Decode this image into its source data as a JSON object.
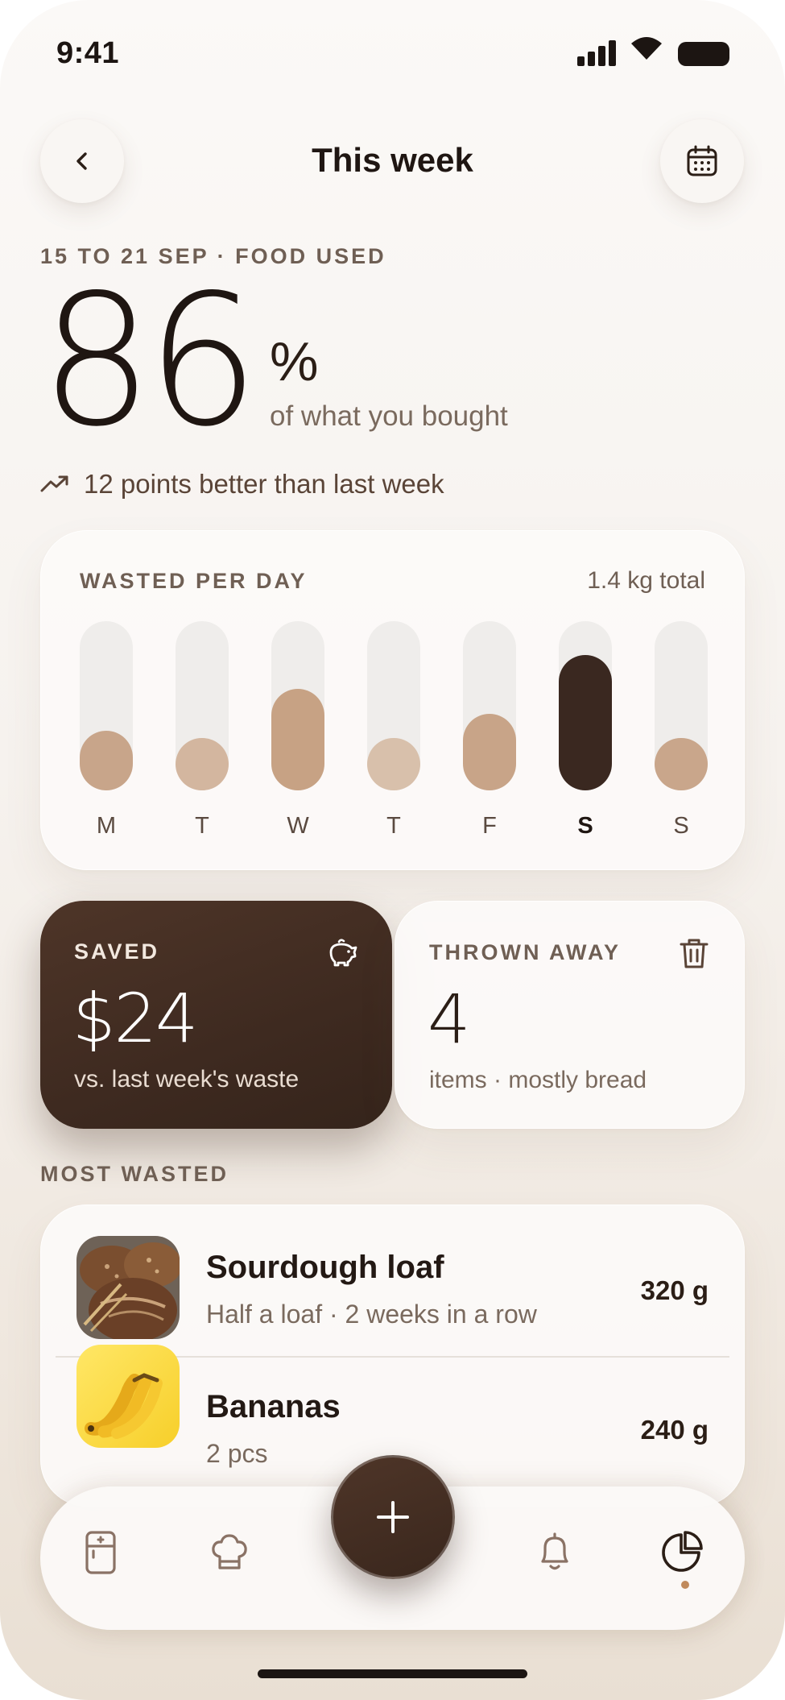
{
  "status_bar": {
    "time": "9:41"
  },
  "header": {
    "title": "This week"
  },
  "summary": {
    "eyebrow": "15 TO 21 SEP · FOOD USED",
    "value": "86",
    "unit": "%",
    "unit_sub": "of what you bought",
    "trend": "12 points better than last week"
  },
  "wasted_chart": {
    "label": "WASTED PER DAY",
    "total": "1.4 kg total",
    "days": [
      {
        "day": "M",
        "level": 0.35,
        "color": "#c8a58a"
      },
      {
        "day": "T",
        "level": 0.31,
        "color": "#d3b69f"
      },
      {
        "day": "W",
        "level": 0.6,
        "color": "#c7a284"
      },
      {
        "day": "T",
        "level": 0.31,
        "color": "#d8c0ab"
      },
      {
        "day": "F",
        "level": 0.45,
        "color": "#c8a488"
      },
      {
        "day": "S",
        "level": 0.8,
        "color": "#3a2820",
        "active": true
      },
      {
        "day": "S",
        "level": 0.31,
        "color": "#c9a68b"
      }
    ]
  },
  "saved": {
    "label": "SAVED",
    "value": "$24",
    "sub": "vs. last week's waste",
    "icon": "piggy-bank-icon"
  },
  "thrown": {
    "label": "THROWN AWAY",
    "value": "4",
    "sub": "items · mostly bread",
    "icon": "trash-icon"
  },
  "most_wasted": {
    "label": "MOST WASTED",
    "items": [
      {
        "name": "Sourdough loaf",
        "detail": "Half a loaf · 2 weeks in a row",
        "weight": "320 g"
      },
      {
        "name": "Bananas",
        "detail": "2 pcs",
        "weight": "240 g"
      }
    ]
  },
  "tabs": [
    "fridge-icon",
    "chef-hat-icon",
    "add-icon",
    "bell-icon",
    "pie-chart-icon"
  ]
}
